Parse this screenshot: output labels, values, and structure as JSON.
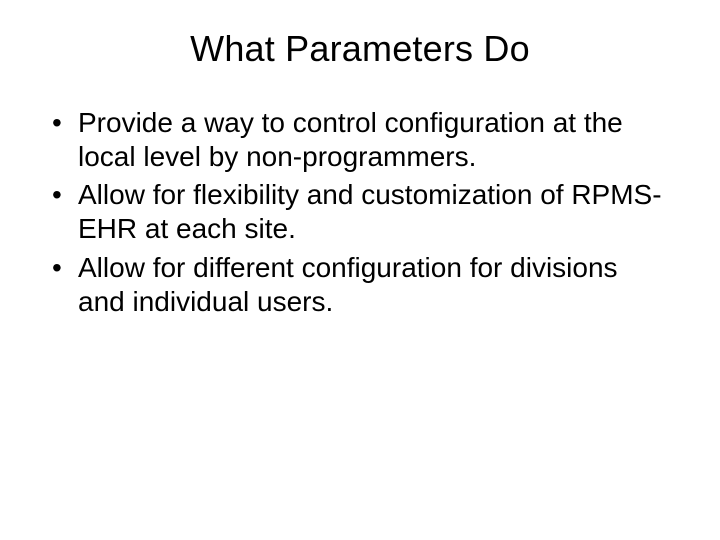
{
  "slide": {
    "title": "What Parameters Do",
    "bullets": [
      "Provide a way to control configuration at the local level by non-programmers.",
      "Allow for flexibility and customization of RPMS-EHR at each site.",
      "Allow for different configuration for divisions and individual users."
    ]
  }
}
